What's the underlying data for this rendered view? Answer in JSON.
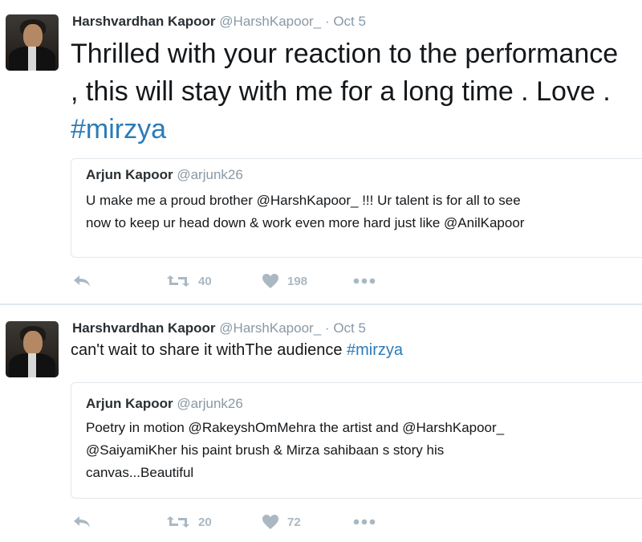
{
  "tweets": [
    {
      "author_name": "Harshvardhan Kapoor",
      "author_handle": "@HarshKapoor_",
      "separator": "·",
      "date": "Oct 5",
      "text": "Thrilled with your reaction to the performance , this will stay with me for a long time . Love .",
      "hashtag": "#mirzya",
      "quoted": {
        "author_name": "Arjun Kapoor",
        "author_handle": "@arjunk26",
        "line1": "U make me a proud brother @HarshKapoor_ !!! Ur talent is for all to see",
        "line2": "now to keep ur head down & work even more hard just like @AnilKapoor"
      },
      "retweets": "40",
      "likes": "198"
    },
    {
      "author_name": "Harshvardhan Kapoor",
      "author_handle": "@HarshKapoor_",
      "separator": "·",
      "date": "Oct 5",
      "text": "can't wait to share it withThe audience",
      "hashtag": "#mirzya",
      "quoted": {
        "author_name": "Arjun Kapoor",
        "author_handle": "@arjunk26",
        "line1": "Poetry in motion @RakeyshOmMehra  the artist and @HarshKapoor_",
        "line2": "@SaiyamiKher his paint brush & Mirza sahibaan s story his",
        "line3": "canvas...Beautiful"
      },
      "retweets": "20",
      "likes": "72"
    }
  ],
  "icons": {
    "reply": "reply-icon",
    "retweet": "retweet-icon",
    "like": "heart-icon",
    "more": "more-icon"
  },
  "colors": {
    "hashtag": "#2b7bb9",
    "muted": "#8899a6",
    "action": "#aab8c2"
  }
}
